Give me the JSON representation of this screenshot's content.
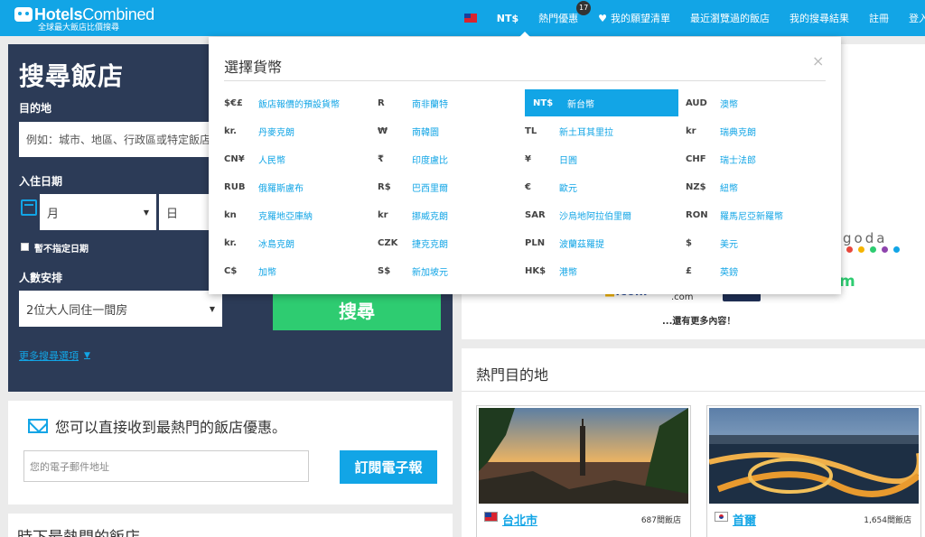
{
  "header": {
    "logo_name_bold": "Hotels",
    "logo_name_light": "Combined",
    "logo_tagline": "全球最大飯店比價搜尋",
    "currency": "NT$",
    "nav": {
      "deals": "熱門優惠",
      "deals_badge": "17",
      "wishlist": "我的願望清單",
      "recent": "最近瀏覽過的飯店",
      "my_results": "我的搜尋結果",
      "register": "註冊",
      "login": "登入"
    }
  },
  "search": {
    "title": "搜尋飯店",
    "destination_label": "目的地",
    "destination_placeholder": "例如：城市、地區、行政區或特定飯店",
    "checkin_label": "入住日期",
    "month_value": "月",
    "day_value": "日",
    "no_date_label": "暫不指定日期",
    "guests_label": "人數安排",
    "guests_value": "2位大人同住一間房",
    "search_button": "搜尋",
    "more_options": "更多搜尋選項"
  },
  "newsletter": {
    "title": "您可以直接收到最熱門的飯店優惠。",
    "email_placeholder": "您的電子郵件地址",
    "subscribe_button": "訂閱電子報"
  },
  "hot_hotels": {
    "title": "時下最熱門的飯店"
  },
  "partners": {
    "goda": "goda",
    "m": "m",
    "com1": ".com",
    "com2": ".com",
    "more": "...還有更多內容！",
    "dot_colors": [
      "#e8473b",
      "#f5b400",
      "#2ecc71",
      "#8e44ad",
      "#12a5e6"
    ]
  },
  "popular": {
    "title": "熱門目的地",
    "destinations": [
      {
        "name": "台北市",
        "count": "687間飯店"
      },
      {
        "name": "首爾",
        "count": "1,654間飯店"
      }
    ]
  },
  "currency_popup": {
    "title": "選擇貨幣",
    "close": "×",
    "columns": [
      [
        {
          "code": "$€£",
          "name": "飯店報價的預設貨幣"
        },
        {
          "code": "kr.",
          "name": "丹麥克朗"
        },
        {
          "code": "CN¥",
          "name": "人民幣"
        },
        {
          "code": "RUB",
          "name": "俄羅斯盧布"
        },
        {
          "code": "kn",
          "name": "克羅地亞庫納"
        },
        {
          "code": "kr.",
          "name": "冰島克朗"
        },
        {
          "code": "C$",
          "name": "加幣"
        }
      ],
      [
        {
          "code": "R",
          "name": "南非蘭特"
        },
        {
          "code": "₩",
          "name": "南韓圜"
        },
        {
          "code": "₹",
          "name": "印度盧比"
        },
        {
          "code": "R$",
          "name": "巴西里爾"
        },
        {
          "code": "kr",
          "name": "挪威克朗"
        },
        {
          "code": "CZK",
          "name": "捷克克朗"
        },
        {
          "code": "S$",
          "name": "新加坡元"
        }
      ],
      [
        {
          "code": "NT$",
          "name": "新台幣",
          "selected": true
        },
        {
          "code": "TL",
          "name": "新土耳其里拉"
        },
        {
          "code": "¥",
          "name": "日圓"
        },
        {
          "code": "€",
          "name": "歐元"
        },
        {
          "code": "SAR",
          "name": "沙烏地阿拉伯里爾"
        },
        {
          "code": "PLN",
          "name": "波蘭茲羅提"
        },
        {
          "code": "HK$",
          "name": "港幣"
        }
      ],
      [
        {
          "code": "AUD",
          "name": "澳幣"
        },
        {
          "code": "kr",
          "name": "瑞典克朗"
        },
        {
          "code": "CHF",
          "name": "瑞士法郎"
        },
        {
          "code": "NZ$",
          "name": "紐幣"
        },
        {
          "code": "RON",
          "name": "羅馬尼亞新羅幣"
        },
        {
          "code": "$",
          "name": "美元"
        },
        {
          "code": "£",
          "name": "英鎊"
        }
      ]
    ]
  }
}
